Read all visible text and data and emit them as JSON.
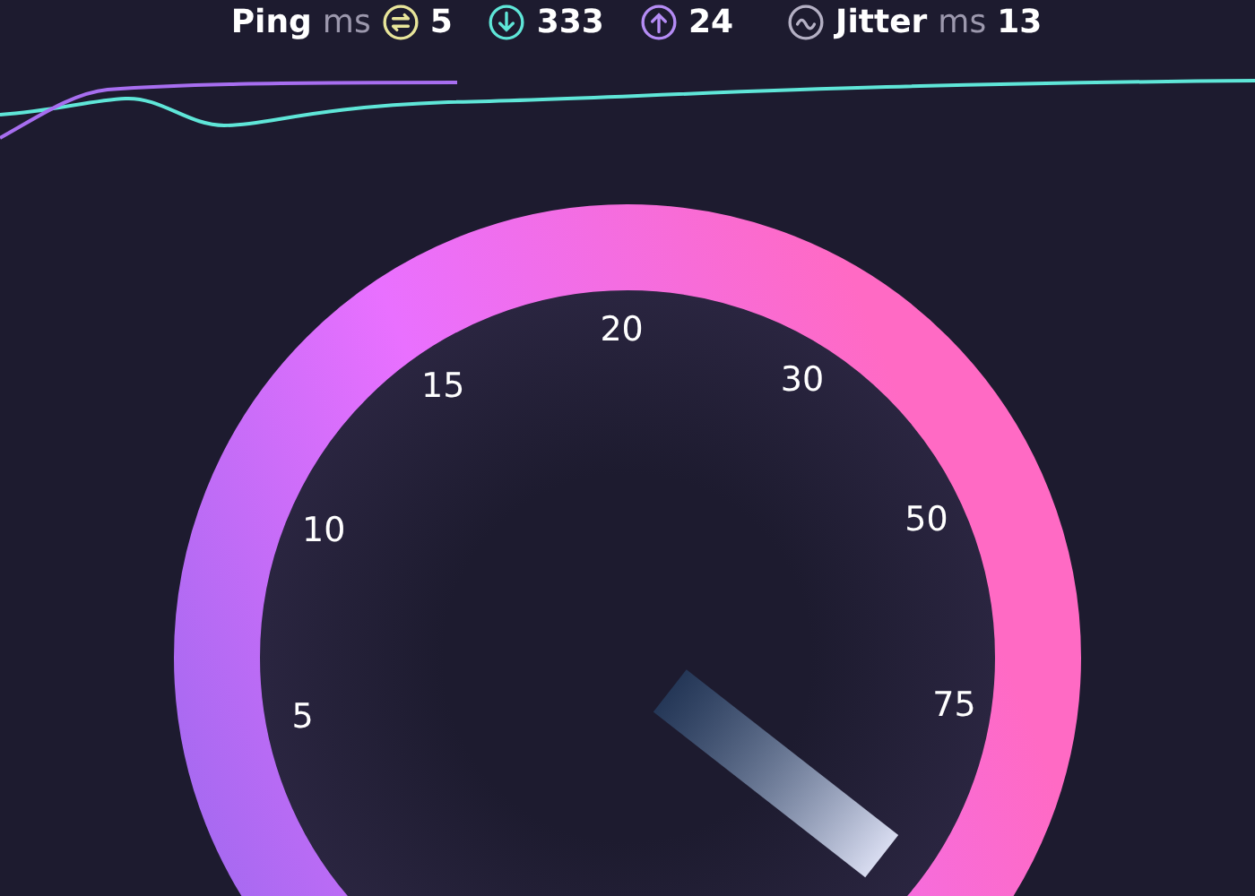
{
  "metrics": [
    {
      "kind": "ping",
      "label": "Ping",
      "unit": "ms",
      "value": "5"
    },
    {
      "kind": "download",
      "value": "333"
    },
    {
      "kind": "upload",
      "value": "24"
    },
    {
      "kind": "jitter",
      "label": "Jitter",
      "unit": "ms",
      "value": "13"
    }
  ],
  "gauge": {
    "scale": [
      "5",
      "10",
      "15",
      "20",
      "30",
      "50",
      "75"
    ]
  }
}
